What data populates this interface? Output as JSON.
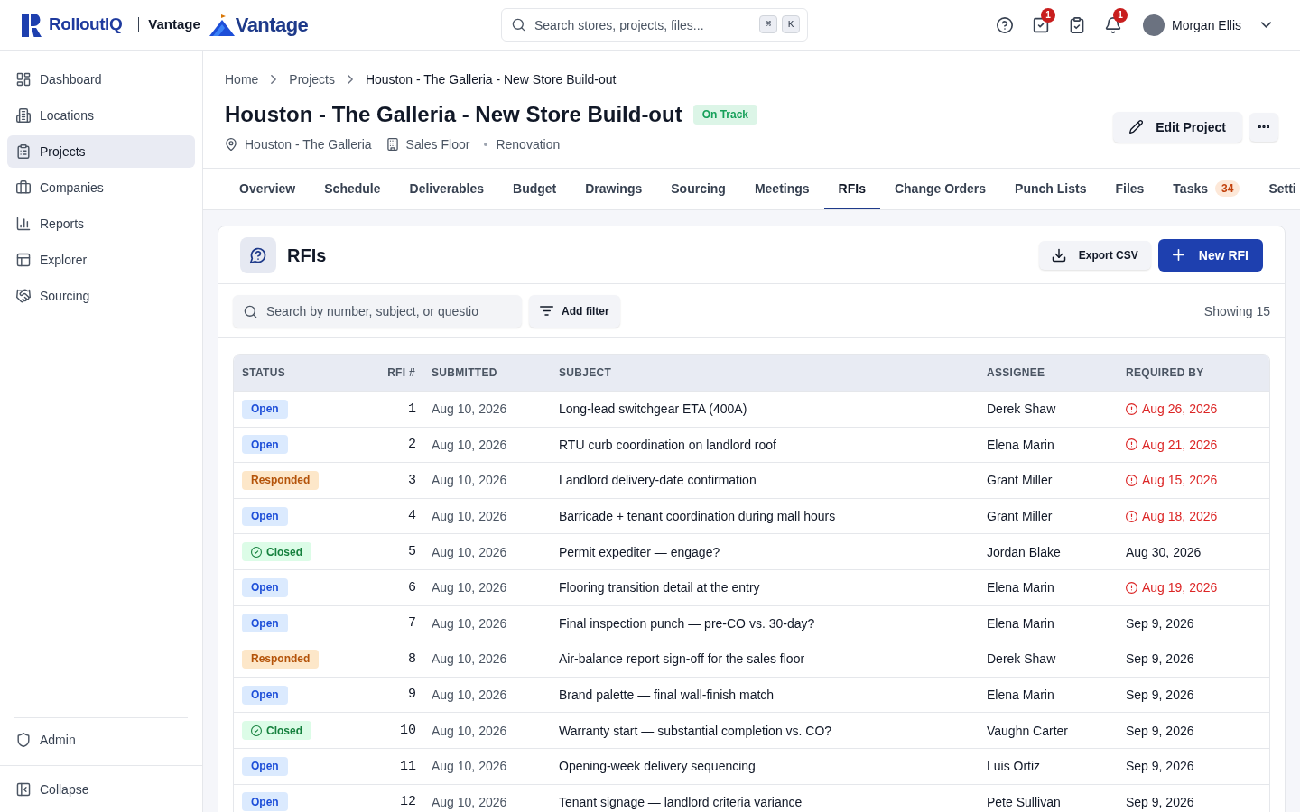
{
  "brand": {
    "name": "RolloutIQ",
    "workspace": "Vantage",
    "logo_text": "Vantage"
  },
  "search": {
    "placeholder": "Search stores, projects, files...",
    "shortcut": [
      "⌘",
      "K"
    ]
  },
  "toolbar_badges": {
    "tasks": "1",
    "notifications": "1"
  },
  "user": {
    "name": "Morgan Ellis"
  },
  "sidebar": {
    "items": [
      {
        "label": "Dashboard",
        "selected": false
      },
      {
        "label": "Locations",
        "selected": false
      },
      {
        "label": "Projects",
        "selected": true
      },
      {
        "label": "Companies",
        "selected": false
      },
      {
        "label": "Reports",
        "selected": false
      },
      {
        "label": "Explorer",
        "selected": false
      },
      {
        "label": "Sourcing",
        "selected": false
      }
    ],
    "footer": [
      {
        "label": "Admin"
      },
      {
        "label": "Collapse"
      }
    ]
  },
  "breadcrumb": [
    "Home",
    "Projects",
    "Houston - The Galleria - New Store Build-out"
  ],
  "project": {
    "title": "Houston - The Galleria - New Store Build-out",
    "status": "On Track",
    "meta": [
      "Houston - The Galleria",
      "Sales Floor",
      "Renovation"
    ],
    "edit_label": "Edit Project"
  },
  "tabs": [
    {
      "label": "Overview",
      "selected": false
    },
    {
      "label": "Schedule",
      "selected": false
    },
    {
      "label": "Deliverables",
      "selected": false
    },
    {
      "label": "Budget",
      "selected": false
    },
    {
      "label": "Drawings",
      "selected": false
    },
    {
      "label": "Sourcing",
      "selected": false
    },
    {
      "label": "Meetings",
      "selected": false
    },
    {
      "label": "RFIs",
      "selected": true
    },
    {
      "label": "Change Orders",
      "selected": false
    },
    {
      "label": "Punch Lists",
      "selected": false
    },
    {
      "label": "Files",
      "selected": false
    },
    {
      "label": "Tasks",
      "selected": false,
      "count": "34"
    },
    {
      "label": "Setti",
      "selected": false
    }
  ],
  "panel": {
    "title": "RFIs",
    "export_label": "Export CSV",
    "new_label": "New RFI",
    "search_placeholder": "Search by number, subject, or questio",
    "filter_label": "Add filter",
    "count": "Showing 15"
  },
  "table": {
    "columns": [
      "STATUS",
      "RFI #",
      "SUBMITTED",
      "SUBJECT",
      "ASSIGNEE",
      "REQUIRED BY"
    ],
    "rows": [
      {
        "status": "Open",
        "kind": "open",
        "number": "1",
        "submitted": "Aug 10, 2026",
        "subject": "Long-lead switchgear ETA (400A)",
        "assignee": "Derek Shaw",
        "required_by": "Aug 26, 2026",
        "overdue": true
      },
      {
        "status": "Open",
        "kind": "open",
        "number": "2",
        "submitted": "Aug 10, 2026",
        "subject": "RTU curb coordination on landlord roof",
        "assignee": "Elena Marin",
        "required_by": "Aug 21, 2026",
        "overdue": true
      },
      {
        "status": "Responded",
        "kind": "responded",
        "number": "3",
        "submitted": "Aug 10, 2026",
        "subject": "Landlord delivery-date confirmation",
        "assignee": "Grant Miller",
        "required_by": "Aug 15, 2026",
        "overdue": true
      },
      {
        "status": "Open",
        "kind": "open",
        "number": "4",
        "submitted": "Aug 10, 2026",
        "subject": "Barricade + tenant coordination during mall hours",
        "assignee": "Grant Miller",
        "required_by": "Aug 18, 2026",
        "overdue": true
      },
      {
        "status": "Closed",
        "kind": "closed",
        "number": "5",
        "submitted": "Aug 10, 2026",
        "subject": "Permit expediter — engage?",
        "assignee": "Jordan Blake",
        "required_by": "Aug 30, 2026",
        "overdue": false
      },
      {
        "status": "Open",
        "kind": "open",
        "number": "6",
        "submitted": "Aug 10, 2026",
        "subject": "Flooring transition detail at the entry",
        "assignee": "Elena Marin",
        "required_by": "Aug 19, 2026",
        "overdue": true
      },
      {
        "status": "Open",
        "kind": "open",
        "number": "7",
        "submitted": "Aug 10, 2026",
        "subject": "Final inspection punch — pre-CO vs. 30-day?",
        "assignee": "Elena Marin",
        "required_by": "Sep 9, 2026",
        "overdue": false
      },
      {
        "status": "Responded",
        "kind": "responded",
        "number": "8",
        "submitted": "Aug 10, 2026",
        "subject": "Air-balance report sign-off for the sales floor",
        "assignee": "Derek Shaw",
        "required_by": "Sep 9, 2026",
        "overdue": false
      },
      {
        "status": "Open",
        "kind": "open",
        "number": "9",
        "submitted": "Aug 10, 2026",
        "subject": "Brand palette — final wall-finish match",
        "assignee": "Elena Marin",
        "required_by": "Sep 9, 2026",
        "overdue": false
      },
      {
        "status": "Closed",
        "kind": "closed",
        "number": "10",
        "submitted": "Aug 10, 2026",
        "subject": "Warranty start — substantial completion vs. CO?",
        "assignee": "Vaughn Carter",
        "required_by": "Sep 9, 2026",
        "overdue": false
      },
      {
        "status": "Open",
        "kind": "open",
        "number": "11",
        "submitted": "Aug 10, 2026",
        "subject": "Opening-week delivery sequencing",
        "assignee": "Luis Ortiz",
        "required_by": "Sep 9, 2026",
        "overdue": false
      },
      {
        "status": "Open",
        "kind": "open",
        "number": "12",
        "submitted": "Aug 10, 2026",
        "subject": "Tenant signage — landlord criteria variance",
        "assignee": "Pete Sullivan",
        "required_by": "Sep 9, 2026",
        "overdue": false
      }
    ]
  }
}
